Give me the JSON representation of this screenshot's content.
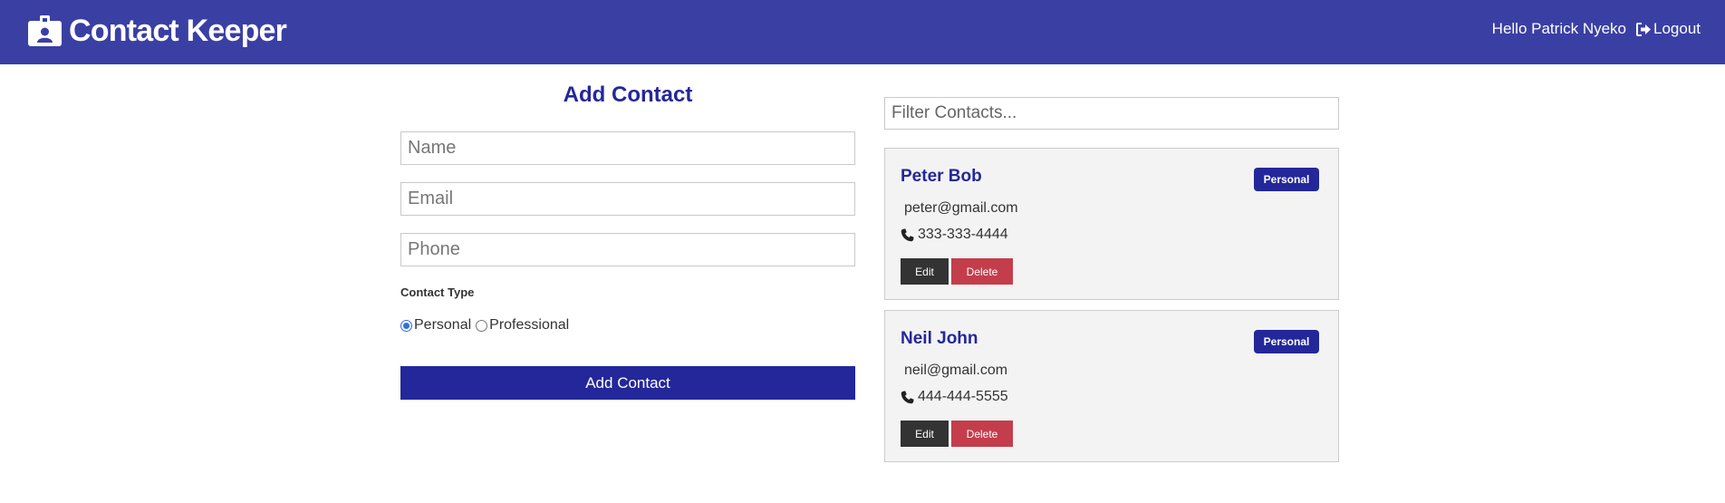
{
  "navbar": {
    "brand_title": "Contact Keeper",
    "brand_icon": "id-badge-icon",
    "greeting": "Hello Patrick Nyeko",
    "logout_label": "Logout",
    "logout_icon": "sign-out-icon",
    "background_color": "#3a3fa3"
  },
  "form": {
    "title": "Add Contact",
    "name_placeholder": "Name",
    "email_placeholder": "Email",
    "phone_placeholder": "Phone",
    "contact_type_label": "Contact Type",
    "type_options": [
      {
        "label": "Personal",
        "checked": true
      },
      {
        "label": "Professional",
        "checked": false
      }
    ],
    "submit_label": "Add Contact"
  },
  "contacts": {
    "filter_placeholder": "Filter Contacts...",
    "items": [
      {
        "name": "Peter Bob",
        "type": "Personal",
        "email": "peter@gmail.com",
        "phone": "333-333-4444",
        "edit_label": "Edit",
        "delete_label": "Delete"
      },
      {
        "name": "Neil John",
        "type": "Personal",
        "email": "neil@gmail.com",
        "phone": "444-444-5555",
        "edit_label": "Edit",
        "delete_label": "Delete"
      }
    ]
  },
  "colors": {
    "primary": "#24279a",
    "dark": "#333333",
    "danger": "#c43d4b",
    "card_bg": "#f3f3f3"
  }
}
